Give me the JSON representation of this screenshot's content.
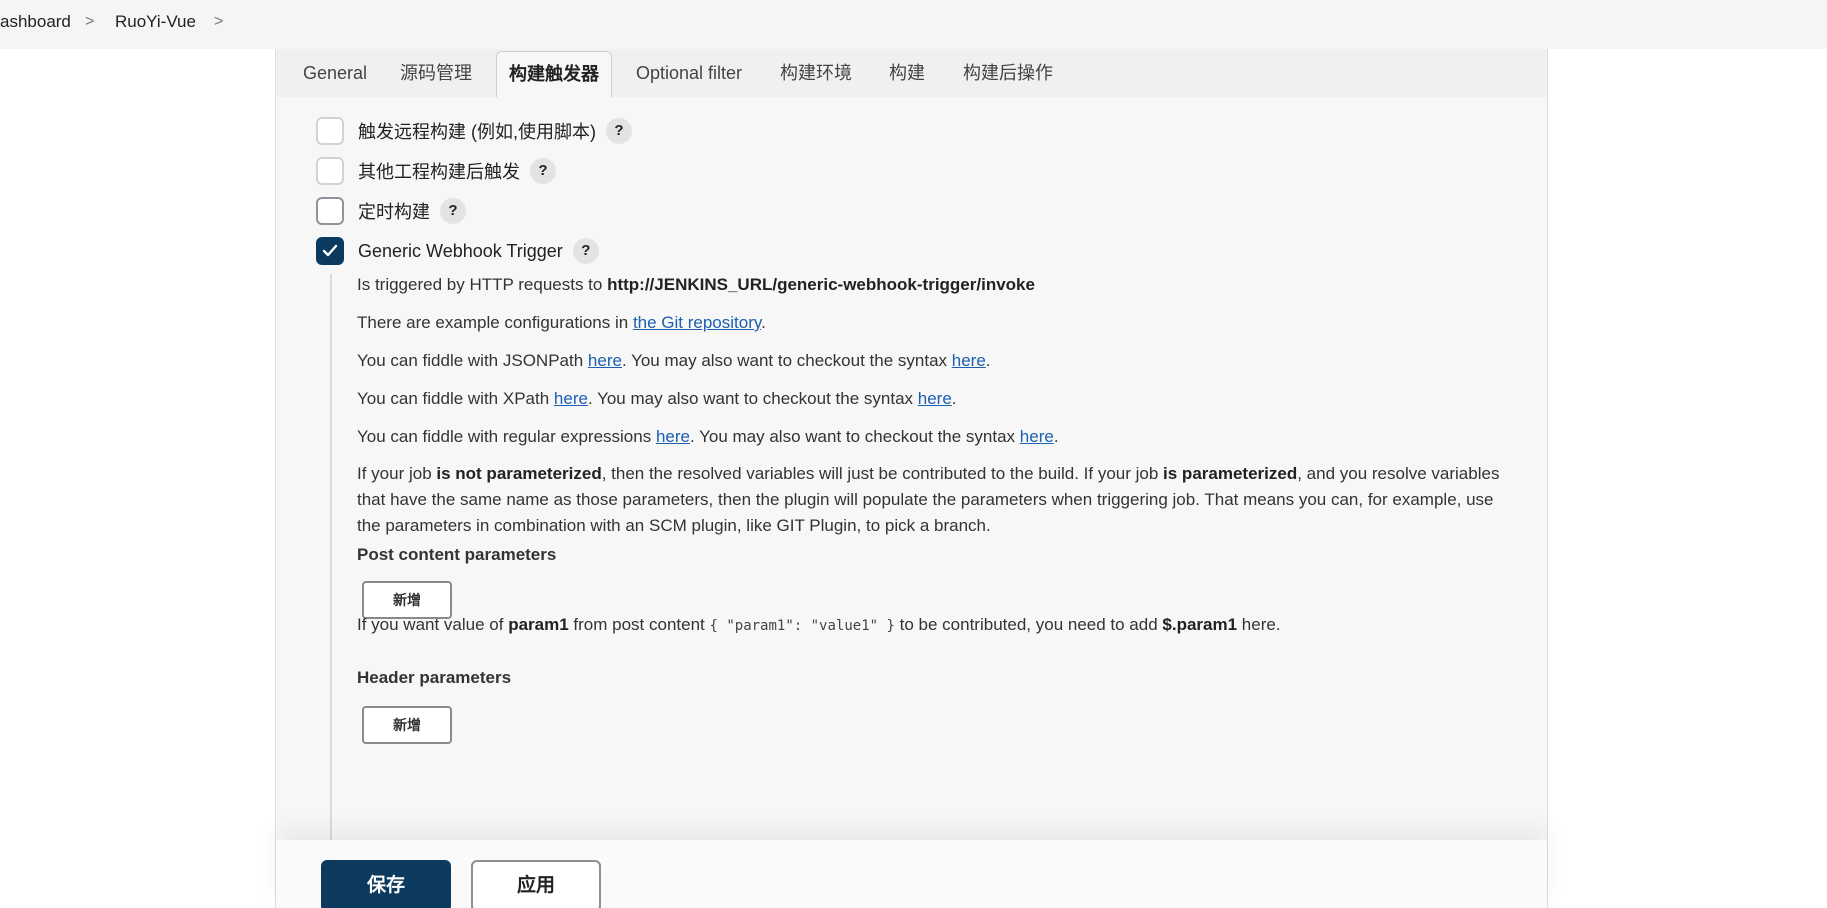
{
  "breadcrumb": {
    "items": [
      "ashboard",
      "RuoYi-Vue"
    ],
    "separator": ">"
  },
  "tabs": [
    {
      "label": "General",
      "active": false
    },
    {
      "label": "源码管理",
      "active": false
    },
    {
      "label": "构建触发器",
      "active": true
    },
    {
      "label": "Optional filter",
      "active": false
    },
    {
      "label": "构建环境",
      "active": false
    },
    {
      "label": "构建",
      "active": false
    },
    {
      "label": "构建后操作",
      "active": false
    }
  ],
  "triggers": [
    {
      "label": "触发远程构建 (例如,使用脚本)",
      "checked": false,
      "help": "?"
    },
    {
      "label": "其他工程构建后触发",
      "checked": false,
      "help": "?"
    },
    {
      "label": "定时构建",
      "checked": false,
      "help": "?"
    },
    {
      "label": "Generic Webhook Trigger",
      "checked": true,
      "help": "?"
    }
  ],
  "webhook": {
    "triggered_prefix": "Is triggered by HTTP requests to ",
    "triggered_url": "http://JENKINS_URL/generic-webhook-trigger/invoke",
    "examples_prefix": "There are example configurations in ",
    "examples_link": "the Git repository",
    "examples_suffix": ".",
    "jsonpath_prefix": "You can fiddle with JSONPath ",
    "xpath_prefix": "You can fiddle with XPath ",
    "regex_prefix": "You can fiddle with regular expressions ",
    "here": "here",
    "syntax_mid": ". You may also want to checkout the syntax ",
    "syntax_end": ".",
    "param_1": "If your job ",
    "param_b1": "is not parameterized",
    "param_2": ", then the resolved variables will just be contributed to the build. If your job ",
    "param_b2": "is parameterized",
    "param_3": ", and you resolve variables that have the same name as those parameters, then the plugin will populate the parameters when triggering job. That means you can, for example, use the parameters in combination with an SCM plugin, like GIT Plugin, to pick a branch.",
    "post_heading": "Post content parameters",
    "add_label": "新增",
    "post_hint_1": "If you want value of ",
    "post_hint_b1": "param1",
    "post_hint_2": " from post content ",
    "post_hint_code": "{ \"param1\": \"value1\" }",
    "post_hint_3": " to be contributed, you need to add ",
    "post_hint_b2": "$.param1",
    "post_hint_4": " here.",
    "header_heading": "Header parameters"
  },
  "actions": {
    "save": "保存",
    "apply": "应用"
  },
  "colors": {
    "primary": "#0b3a5e",
    "link": "#1d5fb0"
  }
}
